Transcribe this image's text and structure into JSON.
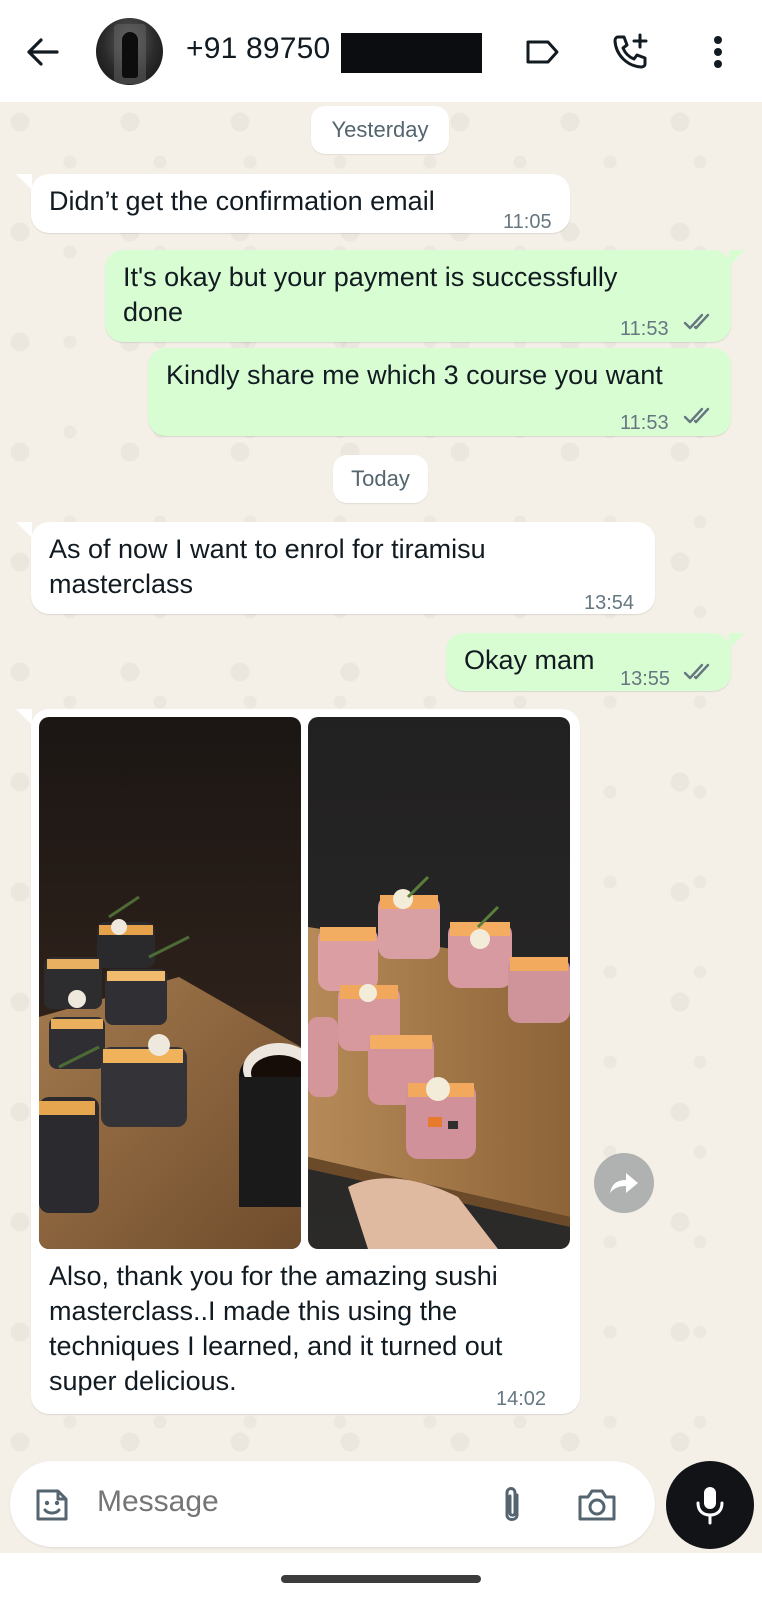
{
  "header": {
    "contact_name": "+91 89750",
    "icons": [
      "back-arrow-icon",
      "label-icon",
      "add-call-icon",
      "more-vertical-icon"
    ]
  },
  "dates": {
    "yesterday": "Yesterday",
    "today": "Today"
  },
  "messages": [
    {
      "direction": "in",
      "text": "Didn’t get the confirmation email",
      "time": "11:05"
    },
    {
      "direction": "out",
      "line1": "It's okay but your payment is successfully",
      "line2": "done",
      "time": "11:53",
      "status": "read"
    },
    {
      "direction": "out",
      "text": "Kindly share me which 3 course you want",
      "time": "11:53",
      "status": "read"
    },
    {
      "direction": "in",
      "line1": "As of now I want to enrol for tiramisu",
      "line2": "masterclass",
      "time": "13:54"
    },
    {
      "direction": "out",
      "text": "Okay mam",
      "time": "13:55",
      "status": "read"
    },
    {
      "direction": "in",
      "type": "media",
      "line1": "Also, thank you for the amazing sushi",
      "line2": "masterclass..I made this using the",
      "line3": "techniques I learned, and it turned out",
      "line4": "super delicious.",
      "time": "14:02"
    }
  ],
  "composer": {
    "placeholder": "Message"
  },
  "colors": {
    "outgoing_bubble": "#d9fdd3",
    "incoming_bubble": "#ffffff",
    "chat_background": "#f4efe7",
    "read_tick": "#53bdeb"
  }
}
